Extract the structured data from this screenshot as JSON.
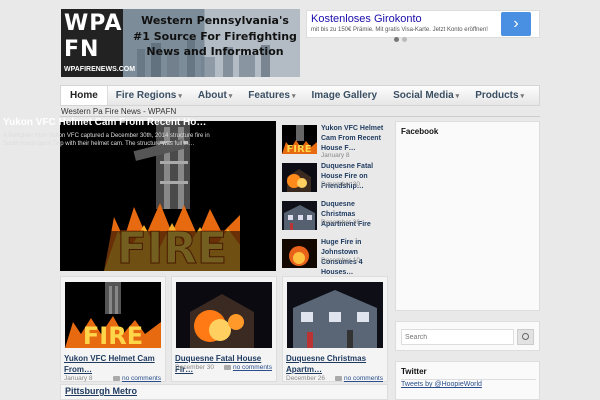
{
  "logo": {
    "letters": "WPA FN",
    "url_text": "WPAFIRENEWS.COM",
    "tagline": "Western Pennsylvania's #1 Source For Firefighting News and Information"
  },
  "ad": {
    "title": "Kostenloses Girokonto",
    "text": "mit bis zu 150€ Prämie. Mit gratis Visa-Karte. Jetzt Konto eröffnen!",
    "arrow": "›"
  },
  "nav": {
    "items": [
      {
        "label": "Home",
        "dropdown": false
      },
      {
        "label": "Fire Regions",
        "dropdown": true
      },
      {
        "label": "About",
        "dropdown": true
      },
      {
        "label": "Features",
        "dropdown": true
      },
      {
        "label": "Image Gallery",
        "dropdown": false
      },
      {
        "label": "Social Media",
        "dropdown": true
      },
      {
        "label": "Products",
        "dropdown": true
      }
    ],
    "caret": "▾"
  },
  "breadcrumb": "Western Pa Fire News - WPAFN",
  "featured": {
    "title": "Yukon VFC Helmet Cam From Recent Ho…",
    "excerpt": "A firefighter from Yukon VFC captured a December 30th, 2014 structure fire in South Huntingdon Twp with their helmet cam. The structure was full in…"
  },
  "side_list": [
    {
      "title": "Yukon VFC Helmet Cam From Recent House F…",
      "date": "January 8"
    },
    {
      "title": "Duquesne Fatal House Fire on Friendship…",
      "date": "December 30"
    },
    {
      "title": "Duquesne Christmas Apartment Fire",
      "date": "December 26"
    },
    {
      "title": "Huge Fire in Johnstown Consumes 4 Houses…",
      "date": "December 10"
    }
  ],
  "cards": [
    {
      "title": "Yukon VFC Helmet Cam From…",
      "date": "January 8",
      "comments": "no comments"
    },
    {
      "title": "Duquesne Fatal House Fir…",
      "date": "December 30",
      "comments": "no comments"
    },
    {
      "title": "Duquesne Christmas Apartm…",
      "date": "December 26",
      "comments": "no comments"
    }
  ],
  "pittsburgh": "Pittsburgh Metro",
  "sidebar": {
    "facebook_title": "Facebook",
    "search_placeholder": "Search",
    "twitter_title": "Twitter",
    "twitter_link": "Tweets by @HoopieWorld"
  },
  "colors": {
    "nav_text": "#3a4f63",
    "link": "#1e3a5f",
    "fire": "#f28c1b"
  }
}
